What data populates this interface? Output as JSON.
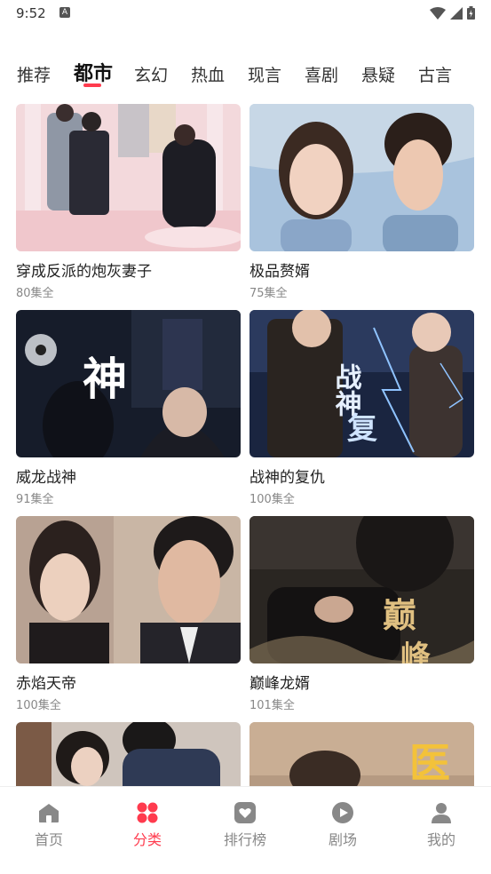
{
  "status_bar": {
    "time": "9:52",
    "notification_icon": "a-icon"
  },
  "tabs": [
    {
      "label": "推荐",
      "active": false
    },
    {
      "label": "都市",
      "active": true
    },
    {
      "label": "玄幻",
      "active": false
    },
    {
      "label": "热血",
      "active": false
    },
    {
      "label": "现言",
      "active": false
    },
    {
      "label": "喜剧",
      "active": false
    },
    {
      "label": "悬疑",
      "active": false
    },
    {
      "label": "古言",
      "active": false
    }
  ],
  "cards": [
    {
      "title": "穿成反派的炮灰妻子",
      "episodes": "80集全"
    },
    {
      "title": "极品赘婿",
      "episodes": "75集全"
    },
    {
      "title": "威龙战神",
      "episodes": "91集全"
    },
    {
      "title": "战神的复仇",
      "episodes": "100集全"
    },
    {
      "title": "赤焰天帝",
      "episodes": "100集全"
    },
    {
      "title": "巅峰龙婿",
      "episodes": "101集全"
    },
    {
      "title": "",
      "episodes": ""
    },
    {
      "title": "",
      "episodes": ""
    }
  ],
  "posters": {
    "p3_text": "神",
    "p4_text": "战神",
    "p4_text2": "复",
    "p6_text": "巅",
    "p6_text2": "峰",
    "p8_text": "医"
  },
  "bottom_nav": [
    {
      "label": "首页",
      "icon": "home-icon",
      "active": false
    },
    {
      "label": "分类",
      "icon": "category-icon",
      "active": true
    },
    {
      "label": "排行榜",
      "icon": "ranking-icon",
      "active": false
    },
    {
      "label": "剧场",
      "icon": "play-icon",
      "active": false
    },
    {
      "label": "我的",
      "icon": "profile-icon",
      "active": false
    }
  ],
  "colors": {
    "accent": "#ff3b4e",
    "inactive": "#888888"
  }
}
